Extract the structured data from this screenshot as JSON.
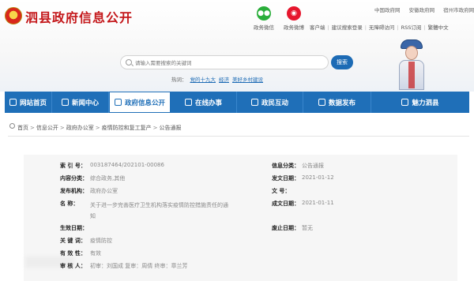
{
  "header": {
    "site_title": "泗县政府信息公开",
    "social": [
      {
        "label": "政务微信",
        "icon": "wechat-icon"
      },
      {
        "label": "政务微博",
        "icon": "weibo-icon"
      }
    ],
    "top_links": [
      "中国政府网",
      "安徽政府网",
      "宿州市政府网"
    ],
    "util_links": [
      "客户端",
      "建议搜索登录",
      "无障碍访问",
      "RSS订阅",
      "繁體中文"
    ],
    "search": {
      "placeholder": "请输入需要搜索的关键词",
      "button": "搜索"
    },
    "hot": {
      "label": "热词：",
      "words": [
        "党的十九大",
        "经济",
        "美好乡村建设"
      ]
    }
  },
  "nav": [
    {
      "label": "网站首页",
      "icon": "home-icon"
    },
    {
      "label": "新闻中心",
      "icon": "news-icon"
    },
    {
      "label": "政府信息公开",
      "icon": "document-icon"
    },
    {
      "label": "在线办事",
      "icon": "service-icon"
    },
    {
      "label": "政民互动",
      "icon": "interaction-icon"
    },
    {
      "label": "数据发布",
      "icon": "data-icon"
    },
    {
      "label": "魅力泗县",
      "icon": "scenery-icon"
    }
  ],
  "nav_active": "政府信息公开",
  "breadcrumb": [
    "首页",
    "信息公开",
    "政府办公室",
    "疫情防控和复工复产",
    "公告通报"
  ],
  "info": {
    "left": [
      {
        "label": "索  引  号：",
        "value": "003187464/202101-00086"
      },
      {
        "label": "内容分类：",
        "value": "综合政务,其他"
      },
      {
        "label": "发布机构：",
        "value": "政府办公室"
      },
      {
        "label": "名    称：",
        "value": "关于进一步完善医疗卫生机构落实疫情防控措施责任的通知"
      },
      {
        "label": "生效日期：",
        "value": ""
      },
      {
        "label": "关  键  词：",
        "value": "疫情防控"
      },
      {
        "label": "有  效  性：",
        "value": "有效"
      },
      {
        "label": "审  核  人：",
        "value": "初审：刘国成    复审：周倩    终审：章兰芳"
      }
    ],
    "right": [
      {
        "label": "信息分类：",
        "value": "公告通报"
      },
      {
        "label": "发文日期：",
        "value": "2021-01-12"
      },
      {
        "label": "文    号：",
        "value": ""
      },
      {
        "label": "成文日期：",
        "value": "2021-01-11"
      },
      {
        "label": "废止日期：",
        "value": "暂无"
      }
    ]
  },
  "colors": {
    "brand_red": "#c4181b",
    "nav_blue": "#1f6fb8",
    "panel_bg": "#f6f6f6"
  }
}
